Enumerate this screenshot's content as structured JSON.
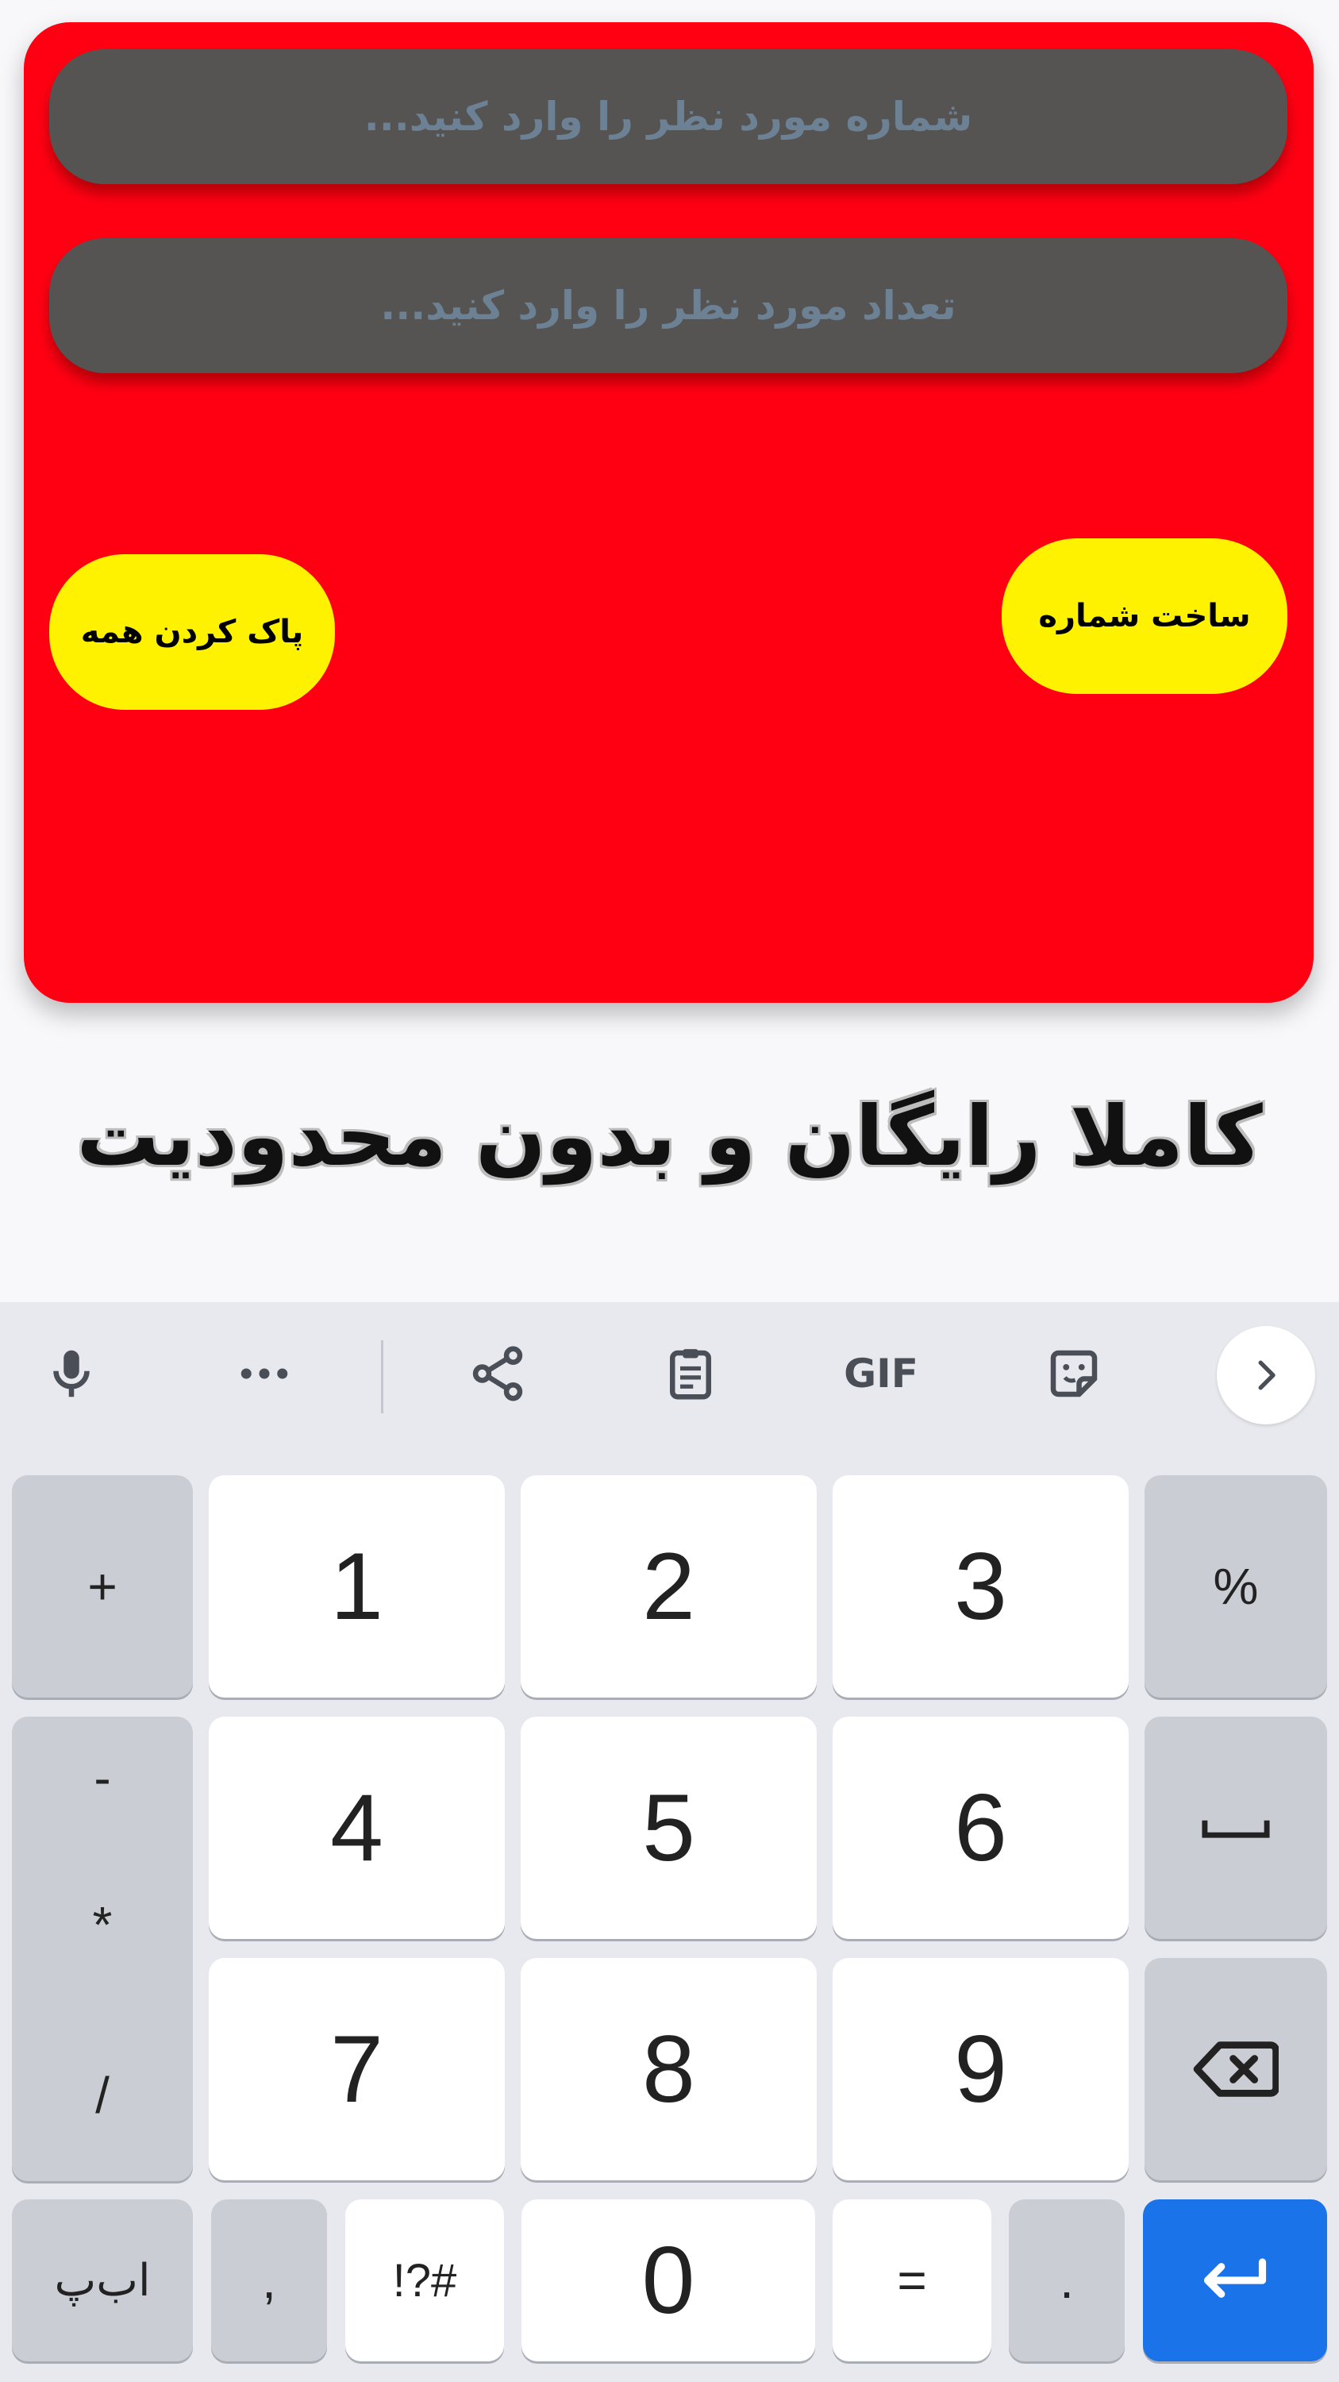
{
  "app": {
    "number_field": {
      "placeholder": "شماره مورد نظر را وارد کنید..."
    },
    "count_field": {
      "placeholder": "تعداد مورد نظر را وارد کنید..."
    },
    "build_button": {
      "label": "ساخت شماره"
    },
    "clear_button": {
      "label": "پاک کردن همه"
    },
    "tagline": "کاملا رایگان و بدون محدودیت",
    "colors": {
      "card": "#ff0013",
      "field": "#555452",
      "button": "#fff200",
      "placeholder": "#6d8194"
    }
  },
  "keyboard": {
    "toolbar": {
      "icons": [
        "microphone-icon",
        "more-icon",
        "share-icon",
        "clipboard-icon",
        "gif-icon",
        "sticker-icon",
        "chevron-right-icon"
      ],
      "gif_label": "GIF"
    },
    "left_column": {
      "plus": "+",
      "minus": "-",
      "star": "*",
      "slash": "/"
    },
    "digits": [
      "1",
      "2",
      "3",
      "4",
      "5",
      "6",
      "7",
      "8",
      "9",
      "0"
    ],
    "percent": "%",
    "alphabet_switch": "اب‌پ",
    "comma": ",",
    "symbols_switch": "!?#",
    "equals": "=",
    "period": ".",
    "accent": "#1a73e8"
  }
}
